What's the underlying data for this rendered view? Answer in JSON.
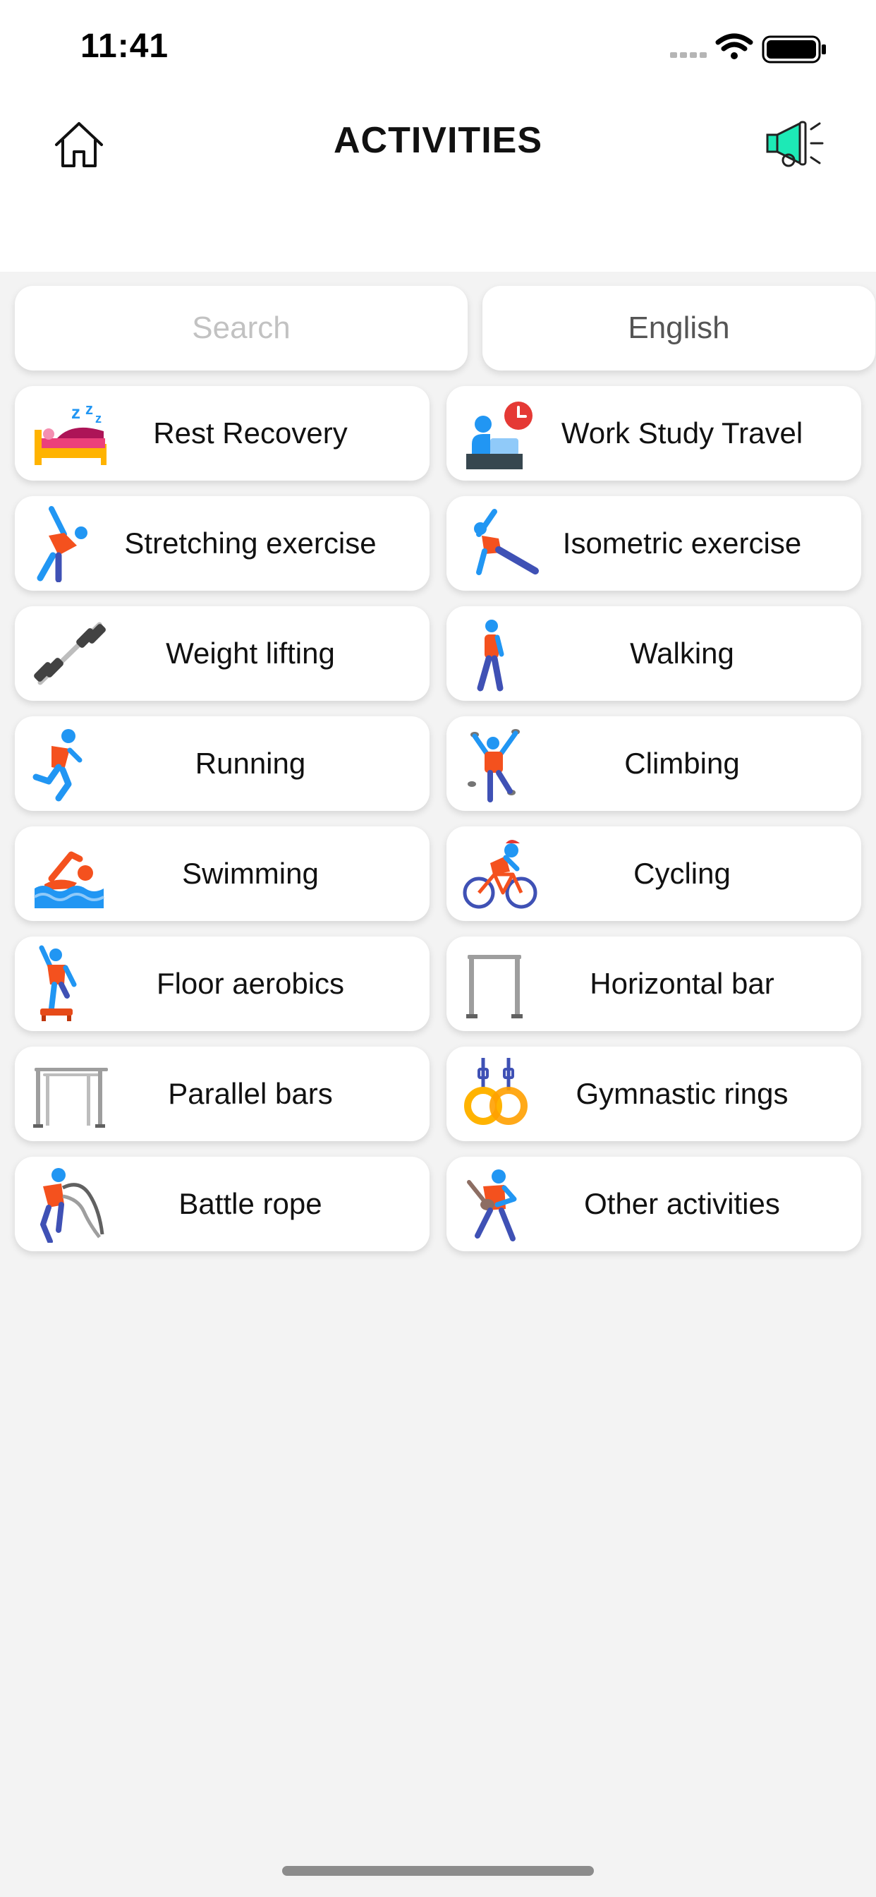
{
  "status_bar": {
    "time": "11:41",
    "icons": [
      "signal-icon",
      "wifi-icon",
      "battery-icon"
    ]
  },
  "header": {
    "title": "ACTIVITIES",
    "left_icon": "home-icon",
    "right_icon": "megaphone-icon"
  },
  "search": {
    "placeholder": "Search",
    "value": ""
  },
  "language": {
    "label": "English"
  },
  "activities": [
    {
      "label": "Rest Recovery",
      "icon": "bed-sleep-icon"
    },
    {
      "label": "Work Study Travel",
      "icon": "desk-clock-icon"
    },
    {
      "label": "Stretching exercise",
      "icon": "stretching-person-icon"
    },
    {
      "label": "Isometric exercise",
      "icon": "side-plank-person-icon"
    },
    {
      "label": "Weight lifting",
      "icon": "dumbbell-icon"
    },
    {
      "label": "Walking",
      "icon": "walking-person-icon"
    },
    {
      "label": "Running",
      "icon": "running-person-icon"
    },
    {
      "label": "Climbing",
      "icon": "climbing-person-icon"
    },
    {
      "label": "Swimming",
      "icon": "swimmer-icon"
    },
    {
      "label": "Cycling",
      "icon": "cyclist-icon"
    },
    {
      "label": "Floor aerobics",
      "icon": "aerobics-step-icon"
    },
    {
      "label": "Horizontal bar",
      "icon": "horizontal-bar-icon"
    },
    {
      "label": "Parallel bars",
      "icon": "parallel-bars-icon"
    },
    {
      "label": "Gymnastic rings",
      "icon": "gymnastic-rings-icon"
    },
    {
      "label": "Battle rope",
      "icon": "battle-rope-icon"
    },
    {
      "label": "Other activities",
      "icon": "other-activities-person-icon"
    }
  ],
  "colors": {
    "background": "#f3f3f3",
    "card": "#ffffff",
    "person_blue": "#2196f3",
    "person_orange": "#f4511e",
    "accent_teal": "#1de9b6"
  }
}
